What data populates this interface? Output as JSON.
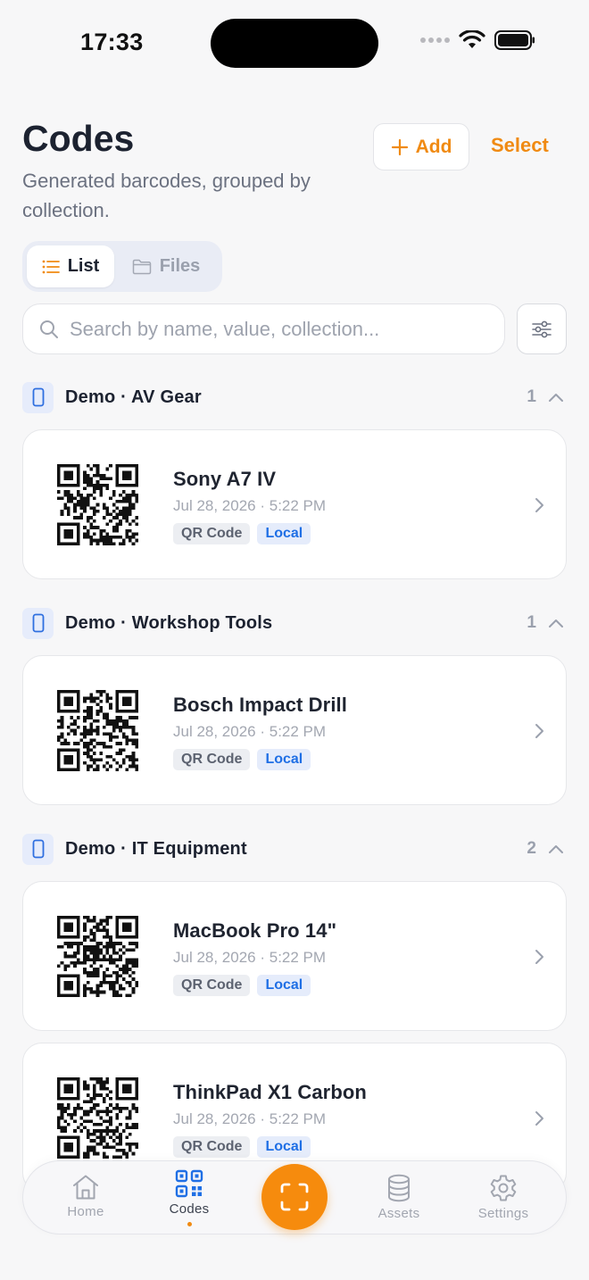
{
  "status_bar": {
    "time": "17:33"
  },
  "header": {
    "title": "Codes",
    "subtitle": "Generated barcodes, grouped by collection.",
    "add_label": "Add",
    "select_label": "Select"
  },
  "view_toggle": {
    "list_label": "List",
    "files_label": "Files",
    "selected": "List"
  },
  "search": {
    "placeholder": "Search by name, value, collection...",
    "value": ""
  },
  "groups": [
    {
      "title": "Demo · AV Gear",
      "count": "1",
      "items": [
        {
          "name": "Sony A7 IV",
          "date": "Jul 28, 2026 · 5:22 PM",
          "type": "QR Code",
          "source": "Local"
        }
      ]
    },
    {
      "title": "Demo · Workshop Tools",
      "count": "1",
      "items": [
        {
          "name": "Bosch Impact Drill",
          "date": "Jul 28, 2026 · 5:22 PM",
          "type": "QR Code",
          "source": "Local"
        }
      ]
    },
    {
      "title": "Demo · IT Equipment",
      "count": "2",
      "items": [
        {
          "name": "MacBook Pro 14\"",
          "date": "Jul 28, 2026 · 5:22 PM",
          "type": "QR Code",
          "source": "Local"
        },
        {
          "name": "ThinkPad X1 Carbon",
          "date": "Jul 28, 2026 · 5:22 PM",
          "type": "QR Code",
          "source": "Local"
        }
      ]
    }
  ],
  "tab_bar": {
    "tabs": [
      {
        "label": "Home",
        "icon": "home-icon"
      },
      {
        "label": "Codes",
        "icon": "qr-grid-icon",
        "active": true
      },
      {
        "label": "Assets",
        "icon": "database-icon"
      },
      {
        "label": "Settings",
        "icon": "gear-icon"
      }
    ],
    "center_action_icon": "scan-icon"
  },
  "colors": {
    "accent": "#f08a12",
    "scan_button": "#f68b0d",
    "tag_local": "#1f6fe5",
    "active_tab": "#1f6fe5"
  }
}
